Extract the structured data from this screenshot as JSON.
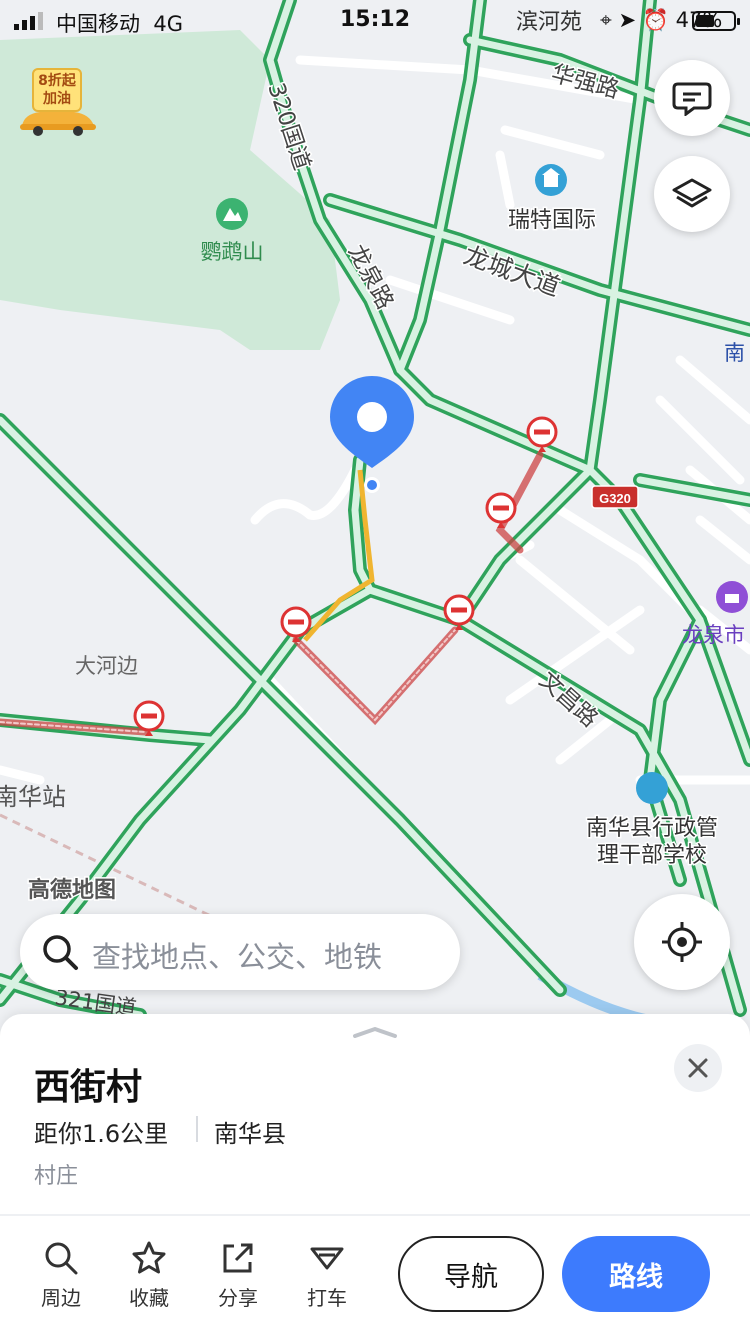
{
  "status_bar": {
    "carrier": "中国移动",
    "network": "4G",
    "time": "15:12",
    "battery": "47%"
  },
  "map": {
    "labels": {
      "yingge_mountain": "鹦鹉山",
      "national_road_320": "320国道",
      "longquan_road": "龙泉路",
      "huaqiang_road": "华强路",
      "longcheng_avenue": "龙城大道",
      "ruite_international": "瑞特国际",
      "binhe_garden": "滨河苑",
      "g320_shield": "G320",
      "dahebian": "大河边",
      "nanhua_station": "南华站",
      "wenhua_road": "文昌路",
      "longquan_city": "龙泉市",
      "admin_school_line1": "南华县行政管",
      "admin_school_line2": "理干部学校",
      "national_road_321": "321国道",
      "nan_edge": "南",
      "gaode_watermark": "高德地图"
    },
    "colors": {
      "road_green": "#3cb371",
      "route_yellow": "#f0b530",
      "pin_blue": "#4285f4",
      "closed_red": "#e03c3c"
    }
  },
  "promo": {
    "line1": "8折起",
    "line2": "加油"
  },
  "search": {
    "placeholder": "查找地点、公交、地铁"
  },
  "poi": {
    "title": "西街村",
    "distance": "距你1.6公里",
    "county": "南华县",
    "category": "村庄"
  },
  "actions": {
    "nearby": "周边",
    "favorite": "收藏",
    "share": "分享",
    "taxi": "打车",
    "navigate": "导航",
    "route": "路线"
  }
}
